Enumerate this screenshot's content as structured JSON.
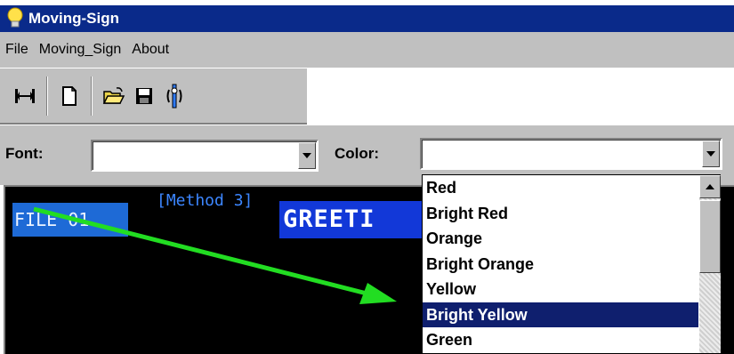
{
  "window": {
    "title": "Moving-Sign"
  },
  "menu": {
    "items": [
      "File",
      "Moving_Sign",
      "About"
    ]
  },
  "toolbar": {
    "buttons": [
      "resize-icon",
      "new-file-icon",
      "open-folder-icon",
      "save-icon",
      "sign-icon"
    ]
  },
  "font": {
    "label": "Font:",
    "value": ""
  },
  "color": {
    "label": "Color:",
    "value": "",
    "options": [
      "Red",
      "Bright Red",
      "Orange",
      "Bright Orange",
      "Yellow",
      "Bright Yellow",
      "Green"
    ],
    "highlighted": "Bright Yellow"
  },
  "display": {
    "file_label": "FILE 01",
    "method_label": "[Method 3]",
    "message": "GREETI"
  },
  "colors": {
    "titlebar": "#0a2a8a",
    "highlight": "#0f1f6e",
    "message_bg": "#1238d8",
    "file_bg": "#1e6ad6",
    "pointer": "#22dd22"
  }
}
